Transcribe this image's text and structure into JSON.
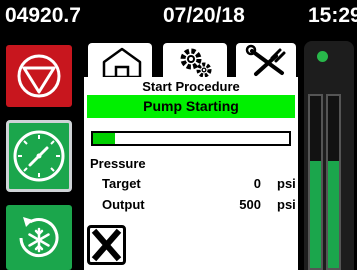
{
  "header": {
    "hours": "04920.7",
    "date": "07/20/18",
    "time": "15:29"
  },
  "tabs": [
    {
      "icon": "home-icon"
    },
    {
      "icon": "gears-icon"
    },
    {
      "icon": "tools-icon",
      "active": true
    }
  ],
  "procedure": {
    "title": "Start Procedure",
    "status": "Pump Starting",
    "progress": 0.11,
    "pressure_label": "Pressure",
    "target_label": "Target",
    "target_value": "0",
    "target_unit": "psi",
    "output_label": "Output",
    "output_value": "500",
    "output_unit": "psi"
  },
  "side_buttons": [
    {
      "icon": "stop-icon",
      "color": "#c8161e"
    },
    {
      "icon": "pressure-gauge-icon",
      "color": "#1ba64c"
    },
    {
      "icon": "defrost-cycle-icon",
      "color": "#1ba64c"
    }
  ],
  "level_gauge": {
    "levels": [
      0.62,
      0.62
    ],
    "color": "#1ba64c"
  },
  "colors": {
    "status": "#00f000",
    "progress": "#00d000",
    "stop": "#c8161e",
    "accent": "#1ba64c"
  }
}
